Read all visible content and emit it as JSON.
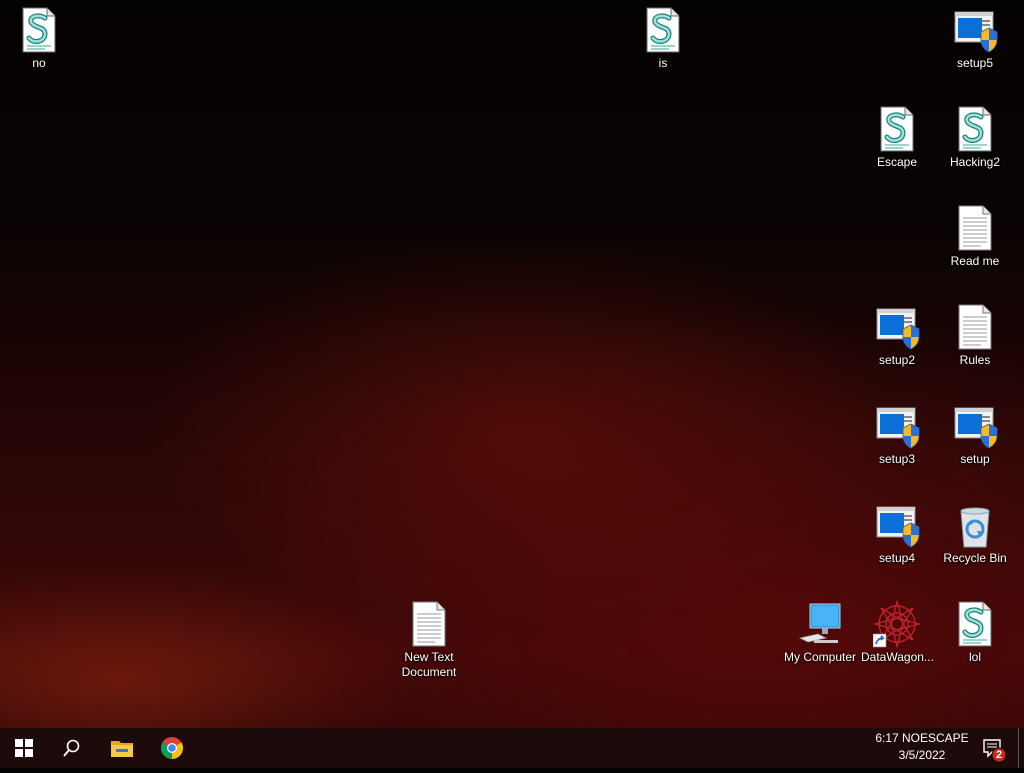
{
  "desktop": {
    "icons": [
      {
        "label": "no",
        "type": "script"
      },
      {
        "label": "is",
        "type": "script"
      },
      {
        "label": "setup5",
        "type": "installer"
      },
      {
        "label": "Escape",
        "type": "script"
      },
      {
        "label": "Hacking2",
        "type": "script"
      },
      {
        "label": "Read me",
        "type": "text"
      },
      {
        "label": "setup2",
        "type": "installer"
      },
      {
        "label": "Rules",
        "type": "text"
      },
      {
        "label": "setup3",
        "type": "installer"
      },
      {
        "label": "setup",
        "type": "installer"
      },
      {
        "label": "setup4",
        "type": "installer"
      },
      {
        "label": "Recycle Bin",
        "type": "recycle-bin"
      },
      {
        "label": "New Text Document",
        "type": "text"
      },
      {
        "label": "My Computer",
        "type": "computer"
      },
      {
        "label": "DataWagon...",
        "type": "shortcut"
      },
      {
        "label": "lol",
        "type": "script"
      }
    ]
  },
  "taskbar": {
    "start_icon": "windows-logo-icon",
    "search_icon": "search-icon",
    "pinned": [
      "file-explorer-icon",
      "chrome-icon"
    ],
    "clock": {
      "time": "6:17 NOESCAPE",
      "date": "3/5/2022"
    },
    "notifications_count": "2"
  },
  "colors": {
    "taskbar": "#1c0b0a",
    "installer_blue": "#0a6fd6",
    "script_teal": "#2aa19a"
  }
}
